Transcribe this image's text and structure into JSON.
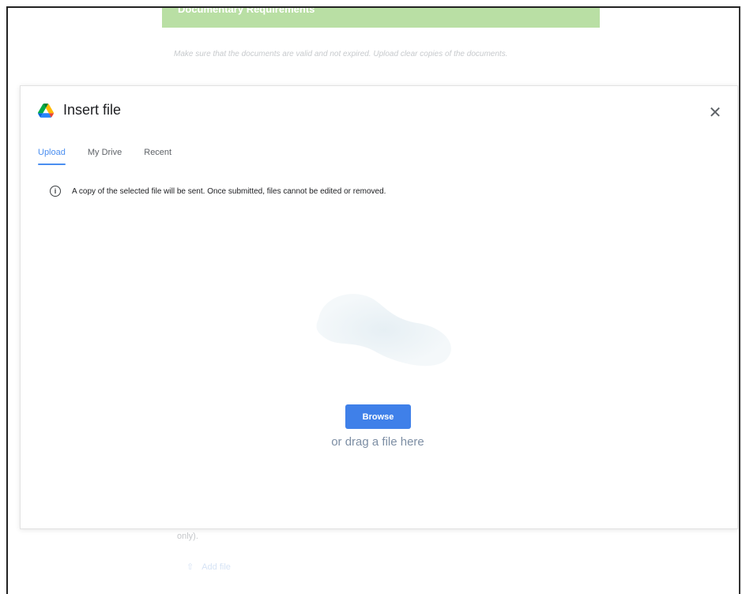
{
  "background": {
    "section_header": "Documentary Requirements",
    "description": "Make sure that the documents are valid and not expired. Upload clear copies of the documents.",
    "trailing_text": "only).",
    "add_file_label": "Add file"
  },
  "dialog": {
    "title": "Insert file",
    "logo_icon": "google-drive-icon",
    "close_icon": "close-icon",
    "tabs": [
      {
        "label": "Upload",
        "active": true
      },
      {
        "label": "My Drive",
        "active": false
      },
      {
        "label": "Recent",
        "active": false
      }
    ],
    "notice": "A copy of the selected file will be sent. Once submitted, files cannot be edited or removed.",
    "browse_label": "Browse",
    "drag_text": "or drag a file here"
  },
  "colors": {
    "accent": "#4a8ef0",
    "browse_button": "#3f80e9",
    "header_green": "#b9dfa4"
  }
}
